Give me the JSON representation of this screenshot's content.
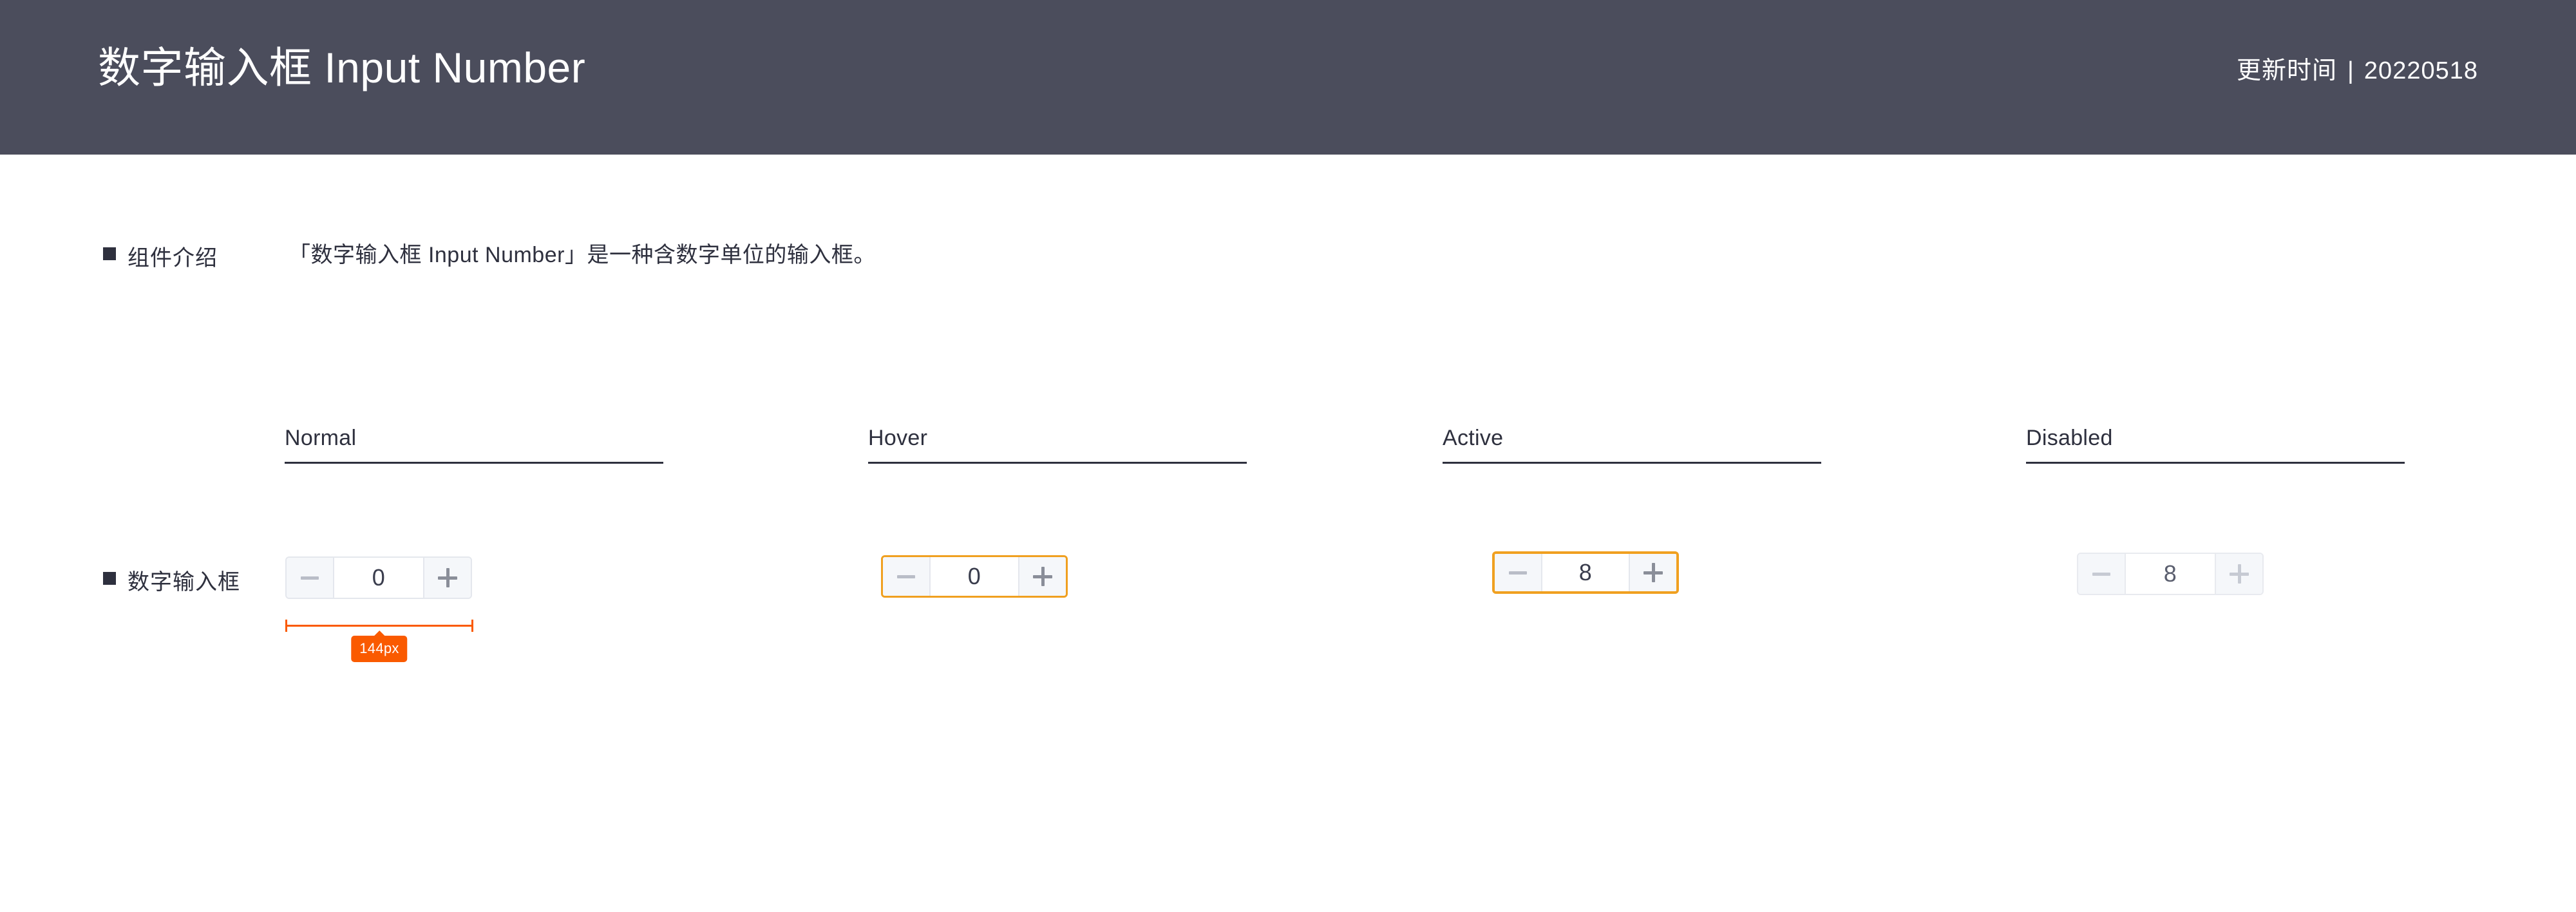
{
  "header": {
    "title": "数字输入框 Input Number",
    "meta_label": "更新时间",
    "meta_separator": "|",
    "meta_date": "20220518",
    "background_color": "#4b4d5c",
    "text_color": "#ffffff"
  },
  "intro": {
    "section_label": "组件介绍",
    "description": "「数字输入框 Input Number」是一种含数字单位的输入框。"
  },
  "states_header": [
    {
      "label": "Normal"
    },
    {
      "label": "Hover"
    },
    {
      "label": "Active"
    },
    {
      "label": "Disabled"
    }
  ],
  "component_row": {
    "section_label": "数字输入框",
    "items": [
      {
        "state": "Normal",
        "decrement_label": "−",
        "value": "0",
        "increment_label": "+",
        "border_color": "#e4e7ed",
        "button_background": "#f5f7fa",
        "field_background": "#ffffff",
        "value_color": "#3a3d4d"
      },
      {
        "state": "Hover",
        "decrement_label": "−",
        "value": "0",
        "increment_label": "+",
        "border_color": "#f0a020",
        "button_background": "#f5f7fa",
        "field_background": "#ffffff",
        "value_color": "#3a3d4d"
      },
      {
        "state": "Active",
        "decrement_label": "−",
        "value": "8",
        "increment_label": "+",
        "border_color": "#f0a020",
        "button_background": "#f5f7fa",
        "field_background": "#ffffff",
        "value_color": "#3a3d4d"
      },
      {
        "state": "Disabled",
        "decrement_label": "−",
        "value": "8",
        "increment_label": "+",
        "border_color": "#e8eaef",
        "button_background": "#f5f7fa",
        "field_background": "#ffffff",
        "value_color": "#5a5e6e"
      }
    ]
  },
  "measurement": {
    "label": "144px",
    "color": "#fa5a00",
    "applies_to": "Normal"
  }
}
